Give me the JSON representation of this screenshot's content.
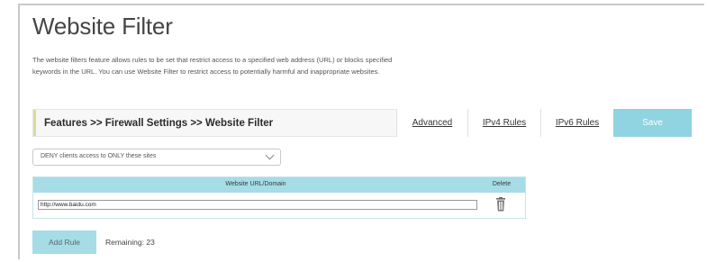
{
  "page": {
    "title": "Website Filter",
    "description": "The website filters feature allows rules to be set that restrict access to a specified web address (URL) or blocks specified keywords in the URL. You can use Website Filter to restrict access to potentially harmful and inappropriate websites."
  },
  "toolbar": {
    "breadcrumb": "Features >> Firewall Settings >> Website Filter",
    "tabs": [
      {
        "label": "Advanced"
      },
      {
        "label": "IPv4 Rules"
      },
      {
        "label": "IPv6 Rules"
      }
    ],
    "save_label": "Save"
  },
  "filter_mode": {
    "selected": "DENY clients access to ONLY these sites"
  },
  "table": {
    "columns": [
      "Website URL/Domain",
      "Delete"
    ],
    "rows": [
      {
        "url": "http://www.baidu.com",
        "delete_icon": "trash-icon"
      }
    ]
  },
  "footer": {
    "add_rule_label": "Add Rule",
    "remaining": "Remaining: 23"
  },
  "colors": {
    "accent": "#8fd4e0",
    "table_header": "#a6dce6"
  }
}
